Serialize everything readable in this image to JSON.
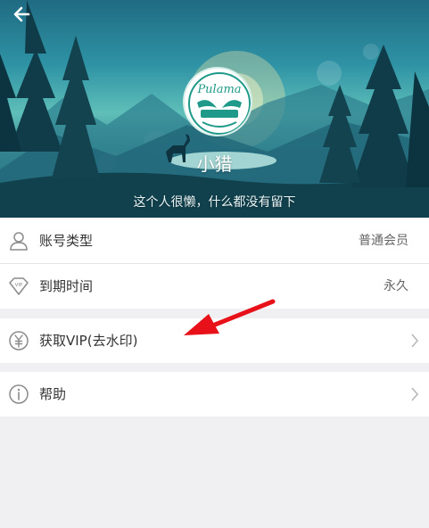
{
  "header": {
    "nickname": "小猎",
    "signature": "这个人很懒，什么都没有留下",
    "avatar_logo": "Pulama 普拉玛",
    "back_icon": "arrow-left-icon"
  },
  "rows": {
    "account_type": {
      "label": "账号类型",
      "value": "普通会员",
      "icon": "user-icon"
    },
    "expiry": {
      "label": "到期时间",
      "value": "永久",
      "icon": "vip-diamond-icon"
    },
    "get_vip": {
      "label": "获取VIP(去水印)",
      "icon": "yuan-icon"
    },
    "help": {
      "label": "帮助",
      "icon": "info-icon"
    }
  },
  "colors": {
    "annotation_arrow": "#e8111a",
    "background": "#f0f0f2",
    "avatar_teal": "#1f9a8a"
  }
}
